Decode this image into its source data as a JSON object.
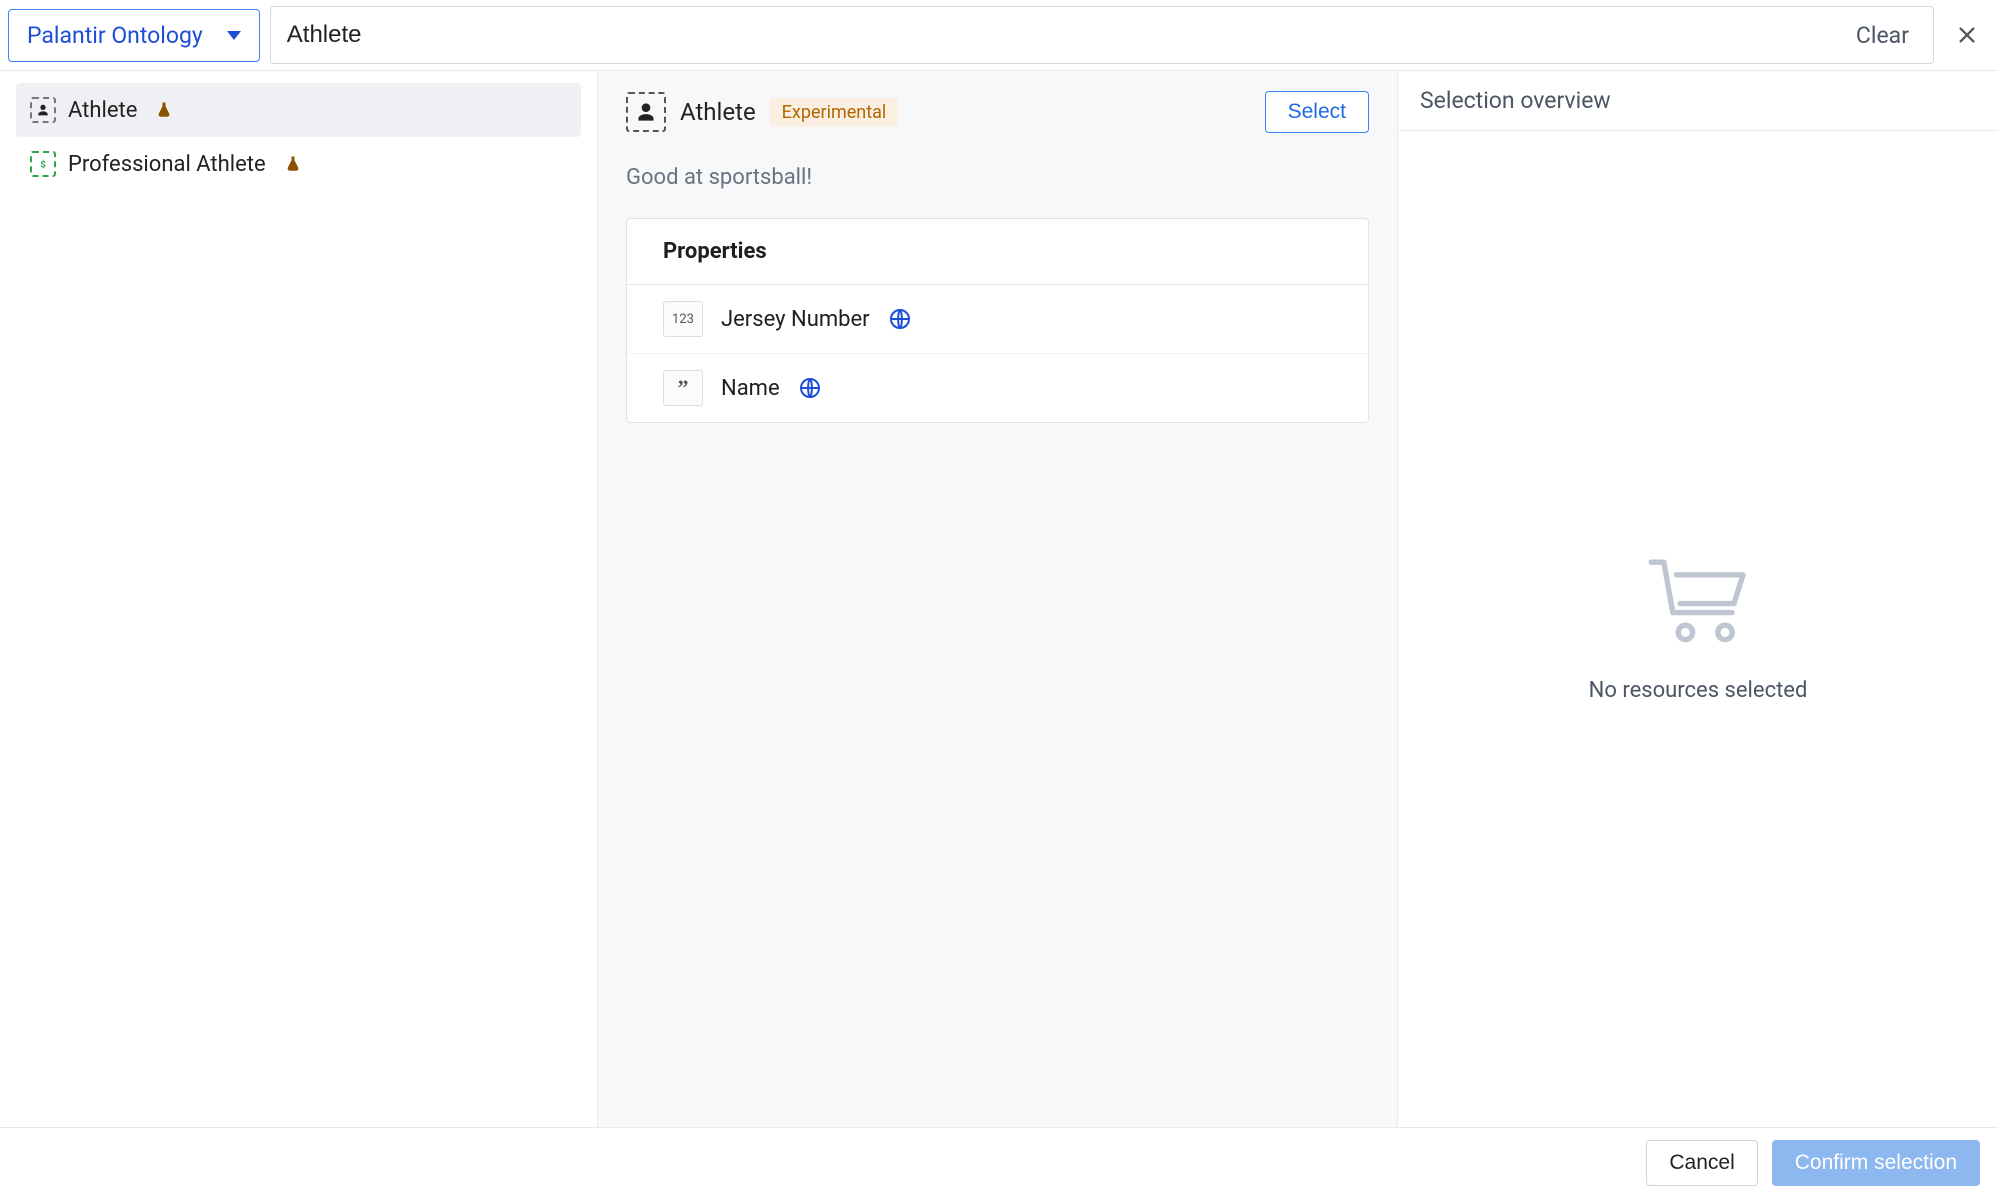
{
  "header": {
    "ontology_select_label": "Palantir Ontology",
    "search_value": "Athlete",
    "clear_label": "Clear"
  },
  "left": {
    "items": [
      {
        "label": "Athlete",
        "icon": "person-dashed",
        "experimental": true,
        "selected": true
      },
      {
        "label": "Professional Athlete",
        "icon": "dollar-dashed",
        "experimental": true,
        "selected": false
      }
    ]
  },
  "detail": {
    "title": "Athlete",
    "badge": "Experimental",
    "select_button": "Select",
    "description": "Good at sportsball!",
    "properties_header": "Properties",
    "properties": [
      {
        "type_indicator": "123",
        "label": "Jersey Number",
        "globe": true
      },
      {
        "type_indicator": "”",
        "label": "Name",
        "globe": true
      }
    ]
  },
  "right": {
    "title": "Selection overview",
    "empty_message": "No resources selected"
  },
  "footer": {
    "cancel": "Cancel",
    "confirm": "Confirm selection"
  }
}
